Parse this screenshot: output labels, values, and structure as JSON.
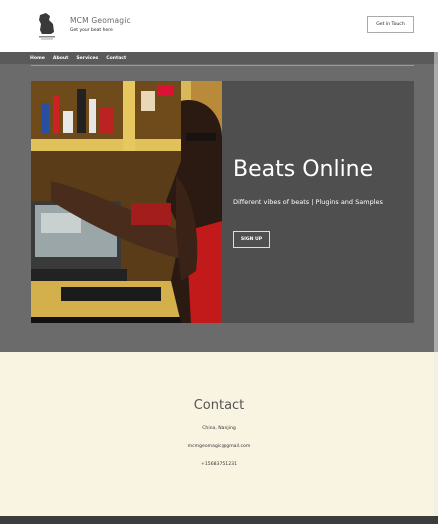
{
  "header": {
    "brand": "MCM Geomagic",
    "tagline": "Get your beat here",
    "cta_label": "Get in Touch"
  },
  "nav": {
    "items": [
      {
        "label": "Home"
      },
      {
        "label": "About"
      },
      {
        "label": "Services"
      },
      {
        "label": "Contact"
      }
    ]
  },
  "hero": {
    "title": "Beats Online",
    "subtitle": "Different vibes of beats | Plugins and Samples",
    "button_label": "SIGN UP",
    "image_description_icon": "producer-photo"
  },
  "contact": {
    "title": "Contact",
    "location": "China, Nanjing",
    "email": "mcmgeomagic@gmail.com",
    "phone": "+15683751231"
  },
  "colors": {
    "dark_bg": "#6b6b6b",
    "hero_panel": "#4f4f4f",
    "contact_bg": "#f9f3e1",
    "footer": "#3c3c3c"
  }
}
